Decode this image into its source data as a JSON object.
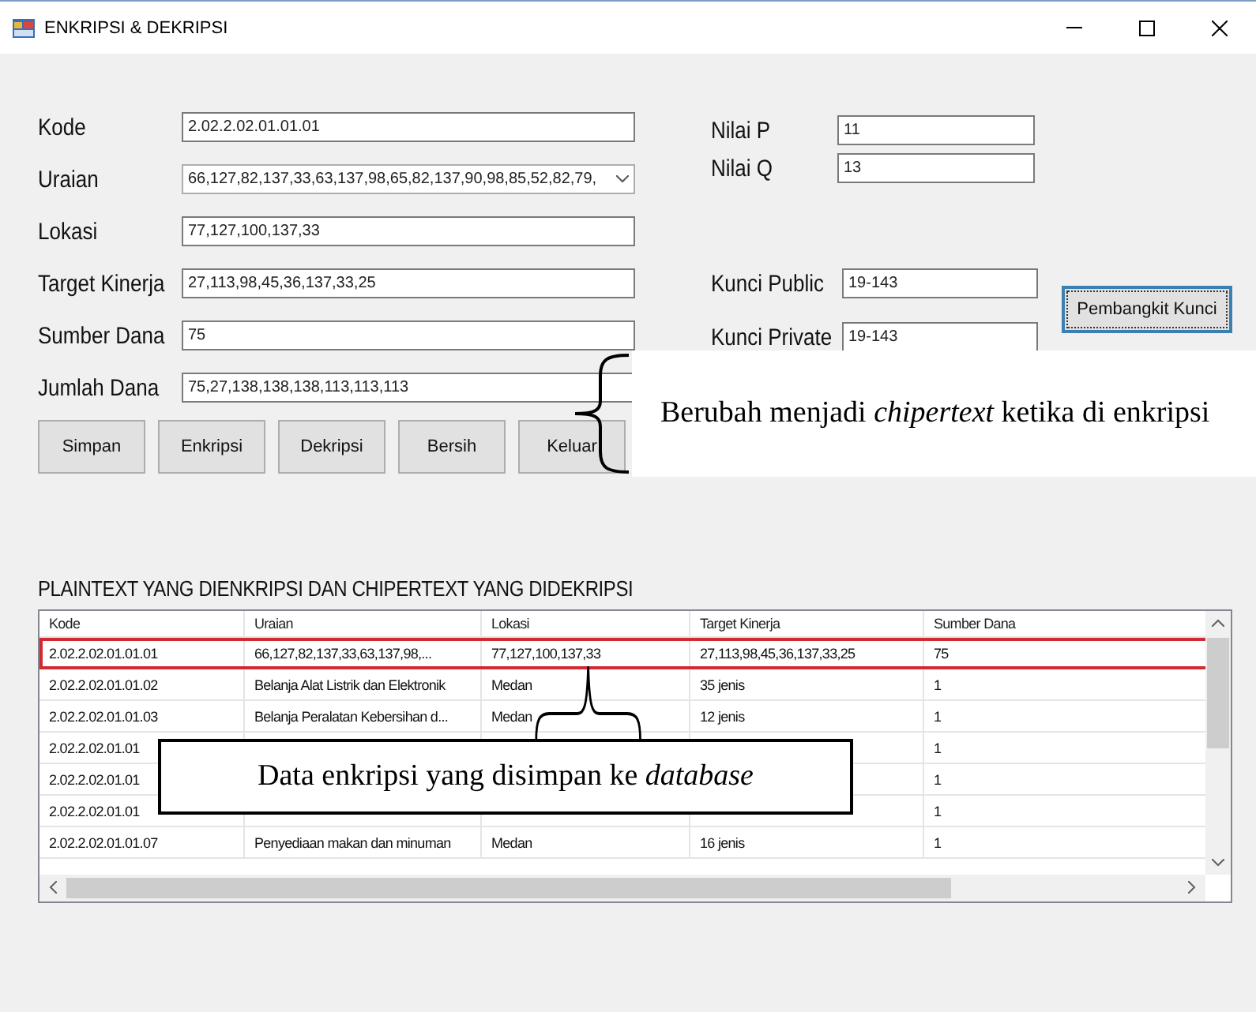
{
  "window": {
    "title": "ENKRIPSI & DEKRIPSI"
  },
  "fields": [
    {
      "label": "Kode",
      "value": "2.02.2.02.01.01.01",
      "kind": "text"
    },
    {
      "label": "Uraian",
      "value": "66,127,82,137,33,63,137,98,65,82,137,90,98,85,52,82,79,",
      "kind": "dropdown"
    },
    {
      "label": "Lokasi",
      "value": "77,127,100,137,33",
      "kind": "text"
    },
    {
      "label": "Target Kinerja",
      "value": "27,113,98,45,36,137,33,25",
      "kind": "text"
    },
    {
      "label": "Sumber Dana",
      "value": "75",
      "kind": "text"
    },
    {
      "label": "Jumlah Dana",
      "value": "75,27,138,138,138,113,113,113",
      "kind": "text"
    }
  ],
  "buttons": [
    "Simpan",
    "Enkripsi",
    "Dekripsi",
    "Bersih",
    "Keluar"
  ],
  "key_fields": [
    {
      "label": "Nilai P",
      "value": "11"
    },
    {
      "label": "Nilai Q",
      "value": "13"
    },
    {
      "label": "Kunci Public",
      "value": "19-143"
    },
    {
      "label": "Kunci Private",
      "value": "19-143"
    }
  ],
  "key_button": {
    "label": "Pembangkit Kunci",
    "focused": true
  },
  "table": {
    "title": "PLAINTEXT YANG DIENKRIPSI DAN CHIPERTEXT YANG DIDEKRIPSI",
    "columns": [
      "Kode",
      "Uraian",
      "Lokasi",
      "Target Kinerja",
      "Sumber Dana"
    ],
    "rows": [
      {
        "selected": true,
        "cells": [
          "2.02.2.02.01.01.01",
          "66,127,82,137,33,63,137,98,...",
          "77,127,100,137,33",
          "27,113,98,45,36,137,33,25",
          "75"
        ]
      },
      {
        "selected": false,
        "cells": [
          "2.02.2.02.01.01.02",
          "Belanja Alat Listrik dan Elektronik",
          "Medan",
          "35 jenis",
          "1"
        ]
      },
      {
        "selected": false,
        "cells": [
          "2.02.2.02.01.01.03",
          "Belanja Peralatan Kebersihan d...",
          "Medan",
          "12 jenis",
          "1"
        ]
      },
      {
        "selected": false,
        "cells": [
          "2.02.2.02.01.01",
          null,
          null,
          null,
          "1"
        ]
      },
      {
        "selected": false,
        "cells": [
          "2.02.2.02.01.01",
          null,
          null,
          null,
          "1"
        ]
      },
      {
        "selected": false,
        "cells": [
          "2.02.2.02.01.01",
          null,
          null,
          null,
          "1"
        ]
      },
      {
        "selected": false,
        "cells": [
          "2.02.2.02.01.01.07",
          "Penyediaan makan dan minuman",
          "Medan",
          "16 jenis",
          "1"
        ]
      }
    ]
  },
  "annotations": [
    {
      "text": "Berubah menjadi *chipertext* ketika di enkripsi"
    },
    {
      "text": "Data enkripsi yang disimpan ke *database*"
    }
  ]
}
